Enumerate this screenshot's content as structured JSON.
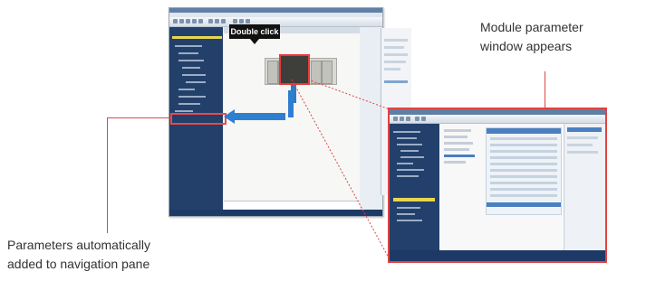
{
  "callout": {
    "label": "Double click"
  },
  "annotations": {
    "right_caption_line1": "Module parameter",
    "right_caption_line2": "window appears",
    "left_caption_line1": "Parameters automatically",
    "left_caption_line2": "added to navigation pane"
  },
  "colors": {
    "highlight": "#e34141",
    "arrow": "#2f7fd0",
    "navigation_pane": "#23406b"
  }
}
